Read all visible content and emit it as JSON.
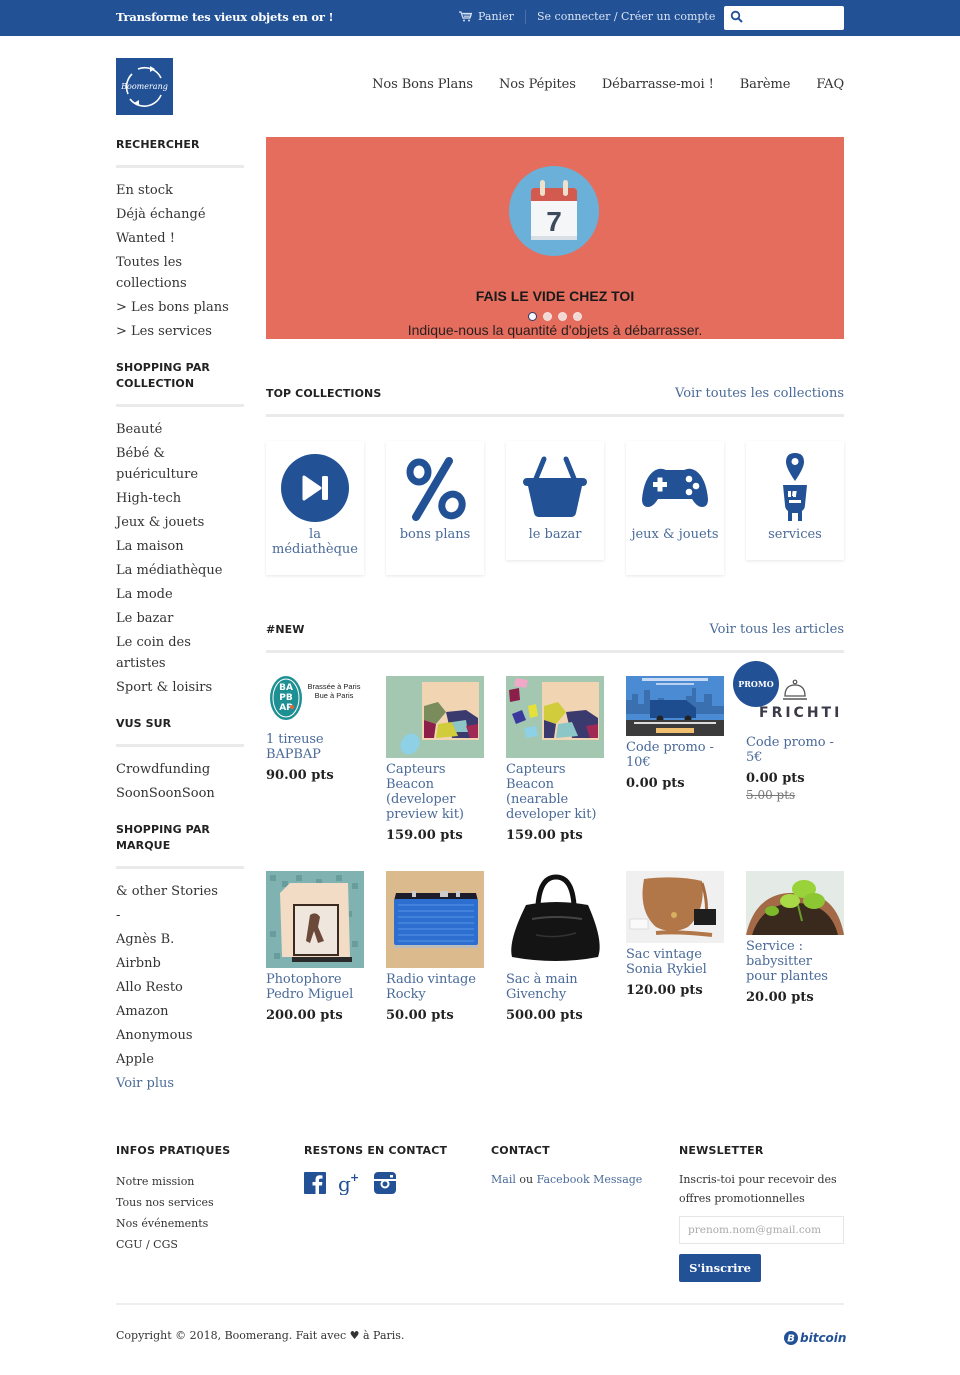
{
  "topbar": {
    "tagline": "Transforme tes vieux objets en or !",
    "cart_label": "Panier",
    "login_label": "Se connecter / Créer un compte",
    "search_placeholder": ""
  },
  "header": {
    "logo_text": "Boomerang",
    "nav": [
      "Nos Bons Plans",
      "Nos Pépites",
      "Débarrasse-moi !",
      "Barème",
      "FAQ"
    ]
  },
  "sidebar": {
    "groups": [
      {
        "heading": "RECHERCHER",
        "items": [
          "En stock",
          "Déjà échangé",
          "Wanted !",
          "Toutes les collections",
          "> Les bons plans",
          "> Les services"
        ]
      },
      {
        "heading": "SHOPPING PAR COLLECTION",
        "items": [
          "Beauté",
          "Bébé & puériculture",
          "High-tech",
          "Jeux & jouets",
          "La maison",
          "La médiathèque",
          "La mode",
          "Le bazar",
          "Le coin des artistes",
          "Sport & loisirs"
        ]
      },
      {
        "heading": "VUS SUR",
        "items": [
          "Crowdfunding",
          "SoonSoonSoon"
        ]
      },
      {
        "heading": "SHOPPING PAR MARQUE",
        "items": [
          "& other Stories",
          "-",
          "Agnès B.",
          "Airbnb",
          "Allo Resto",
          "Amazon",
          "Anonymous",
          "Apple"
        ],
        "more_label": "Voir plus"
      }
    ]
  },
  "slideshow": {
    "calendar_day": "7",
    "title": "FAIS LE VIDE CHEZ TOI",
    "subtitle": "Indique-nous la quantité d'objets à débarrasser.",
    "slide_count": 4,
    "active_slide": 1
  },
  "collections": {
    "heading": "TOP COLLECTIONS",
    "more_label": "Voir toutes les collections",
    "items": [
      {
        "label": "la médiathèque",
        "icon": "play-next-icon"
      },
      {
        "label": "bons plans",
        "icon": "percent-icon"
      },
      {
        "label": "le bazar",
        "icon": "basket-icon"
      },
      {
        "label": "jeux & jouets",
        "icon": "gamepad-icon"
      },
      {
        "label": "services",
        "icon": "location-building-icon"
      }
    ]
  },
  "new_products": {
    "heading": "#NEW",
    "more_label": "Voir tous les articles",
    "items": [
      {
        "name": "1 tireuse BAPBAP",
        "price": "90.00 pts",
        "image_caption": "Brassée à Paris Bue à Paris"
      },
      {
        "name": "Capteurs Beacon (developer preview kit)",
        "price": "159.00 pts"
      },
      {
        "name": "Capteurs Beacon (nearable developer kit)",
        "price": "159.00 pts"
      },
      {
        "name": "Code promo - 10€",
        "price": "0.00 pts"
      },
      {
        "name": "Code promo - 5€",
        "price": "0.00 pts",
        "old_price": "5.00 pts",
        "badge": "PROMO",
        "image_caption": "FRICHTI"
      },
      {
        "name": "Photophore Pedro Miguel",
        "price": "200.00 pts"
      },
      {
        "name": "Radio vintage Rocky",
        "price": "50.00 pts"
      },
      {
        "name": "Sac à main Givenchy",
        "price": "500.00 pts"
      },
      {
        "name": "Sac vintage Sonia Rykiel",
        "price": "120.00 pts"
      },
      {
        "name": "Service : babysitter pour plantes",
        "price": "20.00 pts"
      }
    ]
  },
  "footer": {
    "infos": {
      "heading": "INFOS PRATIQUES",
      "links": [
        "Notre mission",
        "Tous nos services",
        "Nos événements",
        "CGU / CGS"
      ]
    },
    "social": {
      "heading": "RESTONS EN CONTACT",
      "icons": [
        "facebook-icon",
        "google-plus-icon",
        "instagram-icon"
      ]
    },
    "contact": {
      "heading": "CONTACT",
      "mail_label": "Mail",
      "or_label": " ou ",
      "facebook_label": "Facebook Message"
    },
    "newsletter": {
      "heading": "NEWSLETTER",
      "text": "Inscris-toi pour recevoir des offres promotionnelles",
      "placeholder": "prenom.nom@gmail.com",
      "button_label": "S'inscrire"
    },
    "copyright": "Copyright © 2018, Boomerang. Fait avec ♥ à Paris.",
    "payment_label": "bitcoin"
  },
  "colors": {
    "brand_blue": "#225196",
    "link_blue": "#4a6a99",
    "hero_bg": "#e56d5d",
    "calendar_circle": "#6bb0d9"
  }
}
